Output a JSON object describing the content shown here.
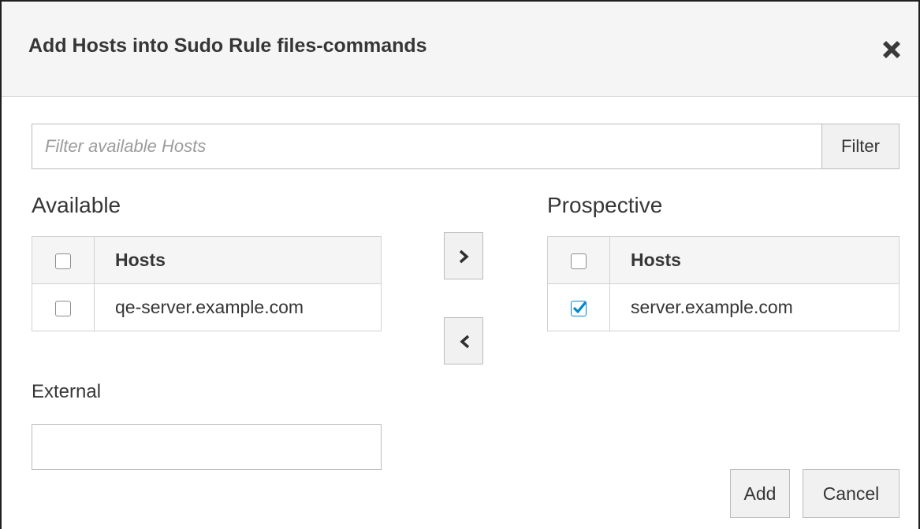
{
  "dialog": {
    "title": "Add Hosts into Sudo Rule files-commands",
    "close_icon": "close-x-icon"
  },
  "filter": {
    "placeholder": "Filter available Hosts",
    "value": "",
    "button_label": "Filter"
  },
  "available": {
    "label": "Available",
    "column_header": "Hosts",
    "header_checked": false,
    "rows": [
      {
        "name": "qe-server.example.com",
        "checked": false
      }
    ]
  },
  "prospective": {
    "label": "Prospective",
    "column_header": "Hosts",
    "header_checked": false,
    "rows": [
      {
        "name": "server.example.com",
        "checked": true
      }
    ]
  },
  "move": {
    "add_icon": "chevron-right-icon",
    "remove_icon": "chevron-left-icon"
  },
  "external": {
    "label": "External",
    "value": ""
  },
  "footer": {
    "add_label": "Add",
    "cancel_label": "Cancel"
  },
  "colors": {
    "check_accent": "#0088ce",
    "header_bg": "#f5f5f5",
    "button_bg": "#f1f1f1",
    "text": "#363636"
  }
}
